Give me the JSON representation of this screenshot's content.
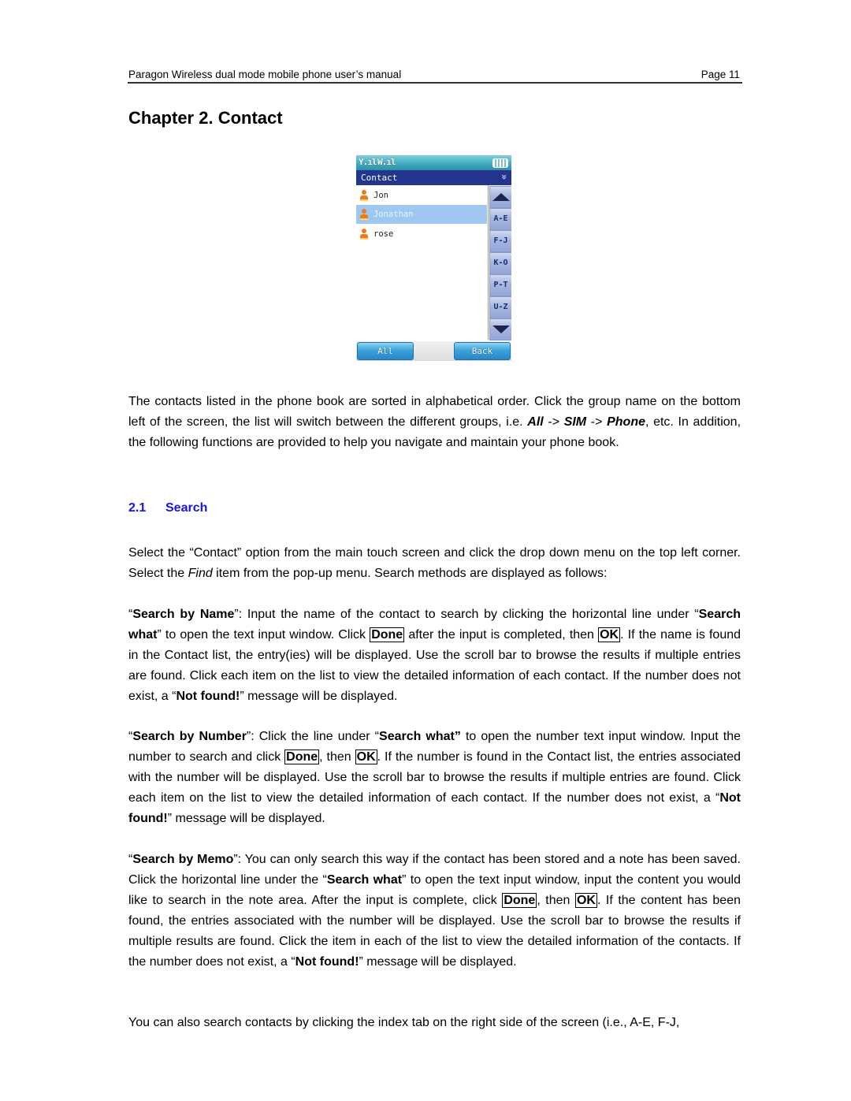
{
  "header": {
    "title": "Paragon Wireless dual mode mobile phone user’s manual",
    "page": "Page 11"
  },
  "chapter_title": "Chapter 2. Contact",
  "phone_screen": {
    "status_signal_1": "Y.ıl",
    "status_signal_2": "W.ıl",
    "title": "Contact",
    "menu_chevron": "»",
    "contacts": [
      {
        "name": "Jon",
        "selected": false
      },
      {
        "name": "Jonathan",
        "selected": true
      },
      {
        "name": "rose",
        "selected": false
      }
    ],
    "index_tabs": [
      "A-E",
      "F-J",
      "K-O",
      "P-T",
      "U-Z"
    ],
    "left_soft_button": "All",
    "right_soft_button": "Back"
  },
  "intro": {
    "p1": "The contacts listed in the phone book are sorted in alphabetical order.  Click the group name on the bottom left of the screen, the list will switch between the different groups, i.e. ",
    "group_all": "All",
    "arrow1": " -> ",
    "group_sim": "SIM",
    "arrow2": " -> ",
    "group_phone": "Phone",
    "p2": ", etc. In addition, the following functions are provided to help you navigate and maintain your phone book."
  },
  "section": {
    "number": "2.1",
    "title": "Search"
  },
  "search_intro": {
    "a": "Select the “Contact” option from the main touch screen and click the drop down menu on the top left corner. Select the ",
    "find": "Find",
    "b": " item from the pop-up menu. Search methods are displayed as follows:"
  },
  "by_name": {
    "q1": "“",
    "label": "Search by Name",
    "a": "”: Input the name of the contact to search by clicking the horizontal line under “",
    "search_what": "Search what",
    "b": "” to open the text input window. Click ",
    "done": "Done",
    "c": " after the input is completed, then ",
    "ok": "OK",
    "d": ". If the name is found in the Contact list, the entry(ies) will be displayed. Use the scroll bar to browse the results if multiple entries are found. Click each item on the list to view the detailed information of each contact. If the number does not exist, a “",
    "not_found": "Not found!",
    "e": "” message will be displayed."
  },
  "by_number": {
    "q1": "“",
    "label": "Search by Number",
    "a": "”: Click the line under “",
    "search_what": "Search what”",
    "b": " to open the number text input window. Input the number to search and click ",
    "done": "Done",
    "c": ", then ",
    "ok": "OK",
    "d": ".  If the number is found in the Contact list, the entries associated with the number will be displayed. Use the scroll bar to browse the results if multiple entries are found. Click each item on the list to view the detailed information of each contact. If the number does not exist, a “",
    "not_found": "Not found!",
    "e": "” message will be displayed."
  },
  "by_memo": {
    "q1": "“",
    "label": "Search by Memo",
    "a": "”: You can only search this way if the contact has been stored and a note has been saved. Click the horizontal line under the “",
    "search_what": "Search what",
    "b": "” to open the text input window, input the content you would like to search in the note area. After the input is complete, click ",
    "done": "Done",
    "c": ", then ",
    "ok": "OK",
    "d": ".  If the content has been found, the entries associated with the number will be displayed. Use the scroll bar to browse the results if multiple results are found. Click the item in each of the list to view the detailed information of the contacts. If the number does not exist, a “",
    "not_found": "Not found!",
    "e": "” message will be displayed."
  },
  "index_note": "You can also search contacts by clicking the index tab on the right side of the screen (i.e., A-E, F-J,"
}
